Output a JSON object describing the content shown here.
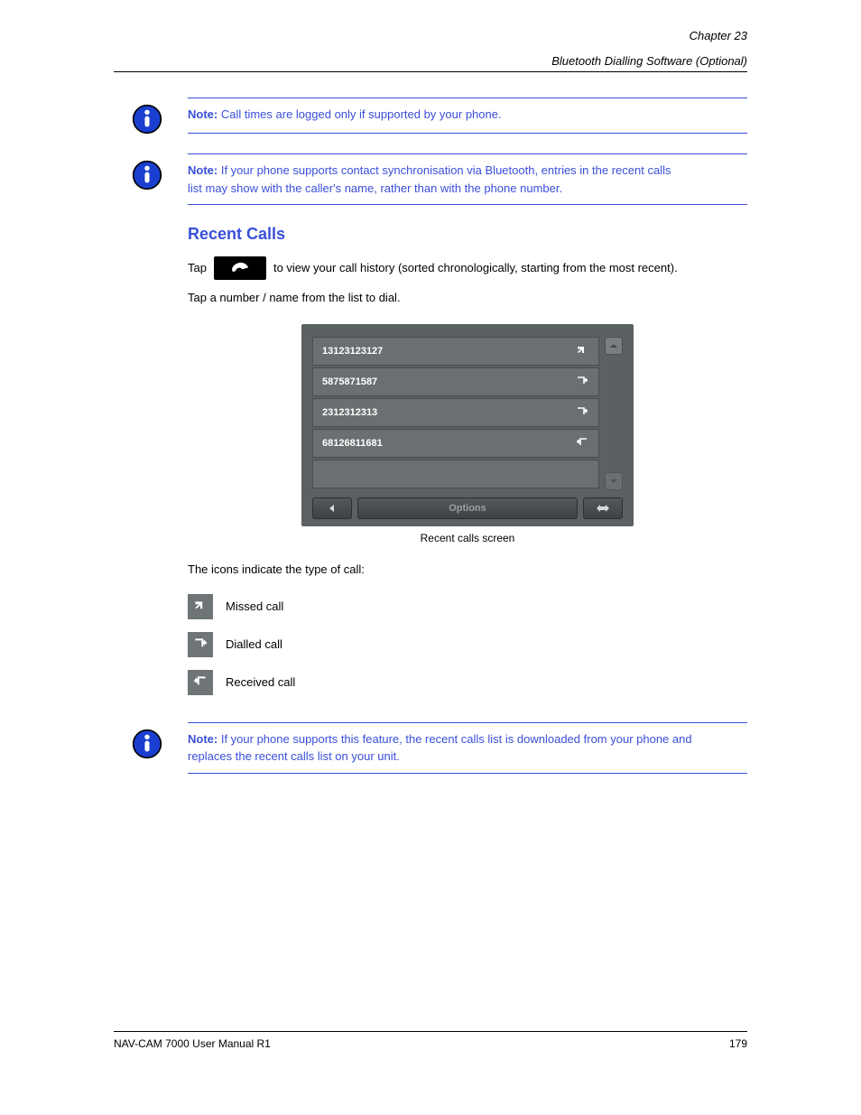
{
  "header": {
    "chapter": "Chapter 23",
    "title": "Bluetooth Dialling Software (Optional)"
  },
  "notes": {
    "note1_prefix": "Note:",
    "note1_body": "Call times are logged only if supported by your phone.",
    "note2_prefix": "Note:",
    "note2_body_l1": "If your phone supports contact synchronisation via Bluetooth, entries in the recent calls",
    "note2_body_l2": "list may show with the caller's name, rather than with the phone number.",
    "note3_prefix": "Note:",
    "note3_body_l1": "If your phone supports this feature, the recent calls list is downloaded from your phone and",
    "note3_body_l2": "replaces the recent calls list on your unit."
  },
  "section": {
    "title": "Recent Calls",
    "intro_pre": "Tap",
    "intro_post": "to view your call history (sorted chronologically, starting from the most recent).",
    "intro_2": "Tap a number / name from the list to dial.",
    "icons_intro": "The icons indicate the type of call:",
    "legend": {
      "missed": "Missed call",
      "dialled": "Dialled call",
      "received": "Received call"
    },
    "figcap": "Recent calls screen"
  },
  "phone_ui": {
    "rows": [
      {
        "number": "13123123127",
        "type": "missed"
      },
      {
        "number": "5875871587",
        "type": "dialled"
      },
      {
        "number": "2312312313",
        "type": "dialled"
      },
      {
        "number": "68126811681",
        "type": "received"
      }
    ],
    "softkeys": {
      "options": "Options"
    }
  },
  "footer": {
    "left": "NAV-CAM 7000 User Manual R1",
    "right": "179"
  }
}
